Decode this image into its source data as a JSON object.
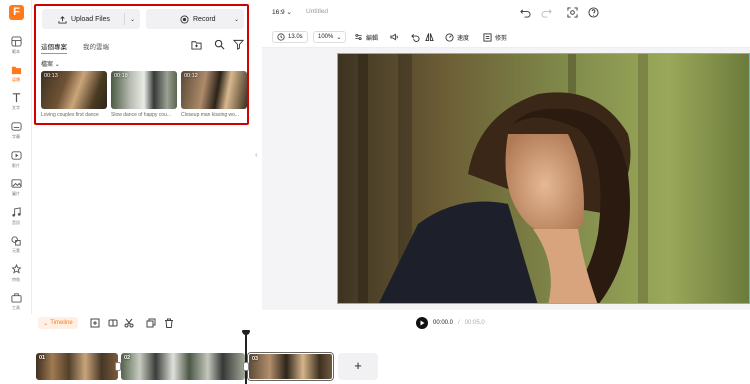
{
  "rail": {
    "logo": "F",
    "items": [
      {
        "label": "範本",
        "icon": "template-icon",
        "active": false
      },
      {
        "label": "媒體",
        "icon": "media-folder-icon",
        "active": true
      },
      {
        "label": "文字",
        "icon": "text-icon",
        "active": false
      },
      {
        "label": "字幕",
        "icon": "subtitle-icon",
        "active": false
      },
      {
        "label": "影片",
        "icon": "video-icon",
        "active": false
      },
      {
        "label": "圖片",
        "icon": "image-icon",
        "active": false
      },
      {
        "label": "音訊",
        "icon": "music-icon",
        "active": false
      },
      {
        "label": "元素",
        "icon": "elements-icon",
        "active": false
      },
      {
        "label": "特效",
        "icon": "effects-icon",
        "active": false
      },
      {
        "label": "工具",
        "icon": "tools-icon",
        "active": false
      }
    ]
  },
  "media": {
    "upload_label": "Upload Files",
    "record_label": "Record",
    "tabs": [
      "這個專案",
      "我的雲端"
    ],
    "filter_label": "檔案",
    "items": [
      {
        "duration": "00:13",
        "caption": "Loving couples first dance"
      },
      {
        "duration": "00:18",
        "caption": "Slow dance of happy cou..."
      },
      {
        "duration": "00:12",
        "caption": "Closeup man kissing wo..."
      }
    ]
  },
  "topbar": {
    "ratio": "16:9",
    "title": "Untitled"
  },
  "toolbar": {
    "duration": "13.0s",
    "zoom": "100%",
    "edit_label": "編輯",
    "speed_label": "速度",
    "trim_label": "修剪"
  },
  "player": {
    "current": "00:00.0",
    "separator": "/",
    "total": "00:05.0"
  },
  "timeline": {
    "label": "Timeline",
    "clips": [
      "01",
      "02",
      "03"
    ],
    "add_label": "+"
  },
  "colors": {
    "accent": "#ff7a1a",
    "highlight_box": "#d40000",
    "preview_border": "#38d0e6"
  }
}
